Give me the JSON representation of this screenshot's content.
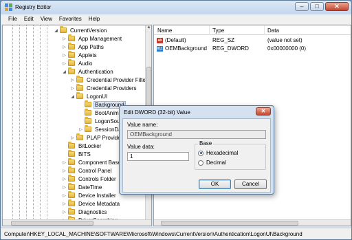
{
  "window": {
    "title": "Registry Editor",
    "minimize_icon": "minimize-icon",
    "maximize_icon": "maximize-icon",
    "close_icon": "close-icon"
  },
  "menu": [
    "File",
    "Edit",
    "View",
    "Favorites",
    "Help"
  ],
  "tree": {
    "items": [
      {
        "label": "CurrentVersion",
        "expander": "◢"
      },
      {
        "label": "App Management",
        "expander": "▷"
      },
      {
        "label": "App Paths",
        "expander": "▷"
      },
      {
        "label": "Applets",
        "expander": "▷"
      },
      {
        "label": "Audio",
        "expander": "▷"
      },
      {
        "label": "Authentication",
        "expander": "◢"
      },
      {
        "label": "Credential Provider Filte",
        "expander": "▷"
      },
      {
        "label": "Credential Providers",
        "expander": "▷"
      },
      {
        "label": "LogonUI",
        "expander": "◢"
      },
      {
        "label": "Background",
        "expander": ""
      },
      {
        "label": "BootAnim",
        "expander": ""
      },
      {
        "label": "LogonSou",
        "expander": ""
      },
      {
        "label": "SessionDa",
        "expander": "▷"
      },
      {
        "label": "PLAP Provider",
        "expander": "▷"
      },
      {
        "label": "BitLocker",
        "expander": ""
      },
      {
        "label": "BITS",
        "expander": ""
      },
      {
        "label": "Component Base",
        "expander": "▷"
      },
      {
        "label": "Control Panel",
        "expander": "▷"
      },
      {
        "label": "Controls Folder",
        "expander": "▷"
      },
      {
        "label": "DateTime",
        "expander": "▷"
      },
      {
        "label": "Device Installer",
        "expander": "▷"
      },
      {
        "label": "Device Metadata",
        "expander": "▷"
      },
      {
        "label": "Diagnostics",
        "expander": "▷"
      },
      {
        "label": "DriverSearching",
        "expander": "▷"
      }
    ]
  },
  "list": {
    "columns": [
      "Name",
      "Type",
      "Data"
    ],
    "rows": [
      {
        "name": "(Default)",
        "type": "REG_SZ",
        "data": "(value not set)",
        "icon": "ab",
        "icon_name": "string-value-icon"
      },
      {
        "name": "OEMBackground",
        "type": "REG_DWORD",
        "data": "0x00000000 (0)",
        "icon": "011",
        "icon_name": "binary-value-icon"
      }
    ]
  },
  "dialog": {
    "title": "Edit DWORD (32-bit) Value",
    "value_name_label": "Value name:",
    "value_name": "OEMBackground",
    "value_data_label": "Value data:",
    "value_data": "1",
    "base_label": "Base",
    "base_options": [
      {
        "label": "Hexadecimal",
        "checked": true
      },
      {
        "label": "Decimal",
        "checked": false
      }
    ],
    "ok_label": "OK",
    "cancel_label": "Cancel"
  },
  "status": {
    "path": "Computer\\HKEY_LOCAL_MACHINE\\SOFTWARE\\Microsoft\\Windows\\CurrentVersion\\Authentication\\LogonUI\\Background"
  }
}
